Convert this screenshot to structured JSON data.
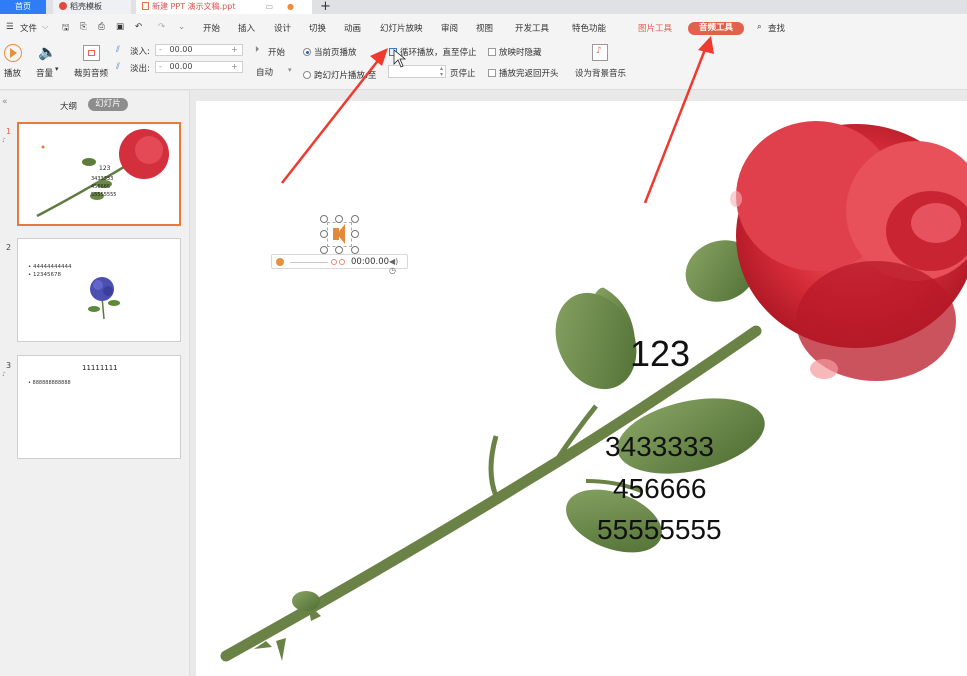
{
  "tabs": {
    "home": "首页",
    "daoke": "稻壳模板",
    "document": "新建 PPT 演示文稿.ppt",
    "new_tab": "+"
  },
  "menu": {
    "file": "文件",
    "items": [
      "开始",
      "插入",
      "设计",
      "切换",
      "动画",
      "幻灯片放映",
      "审阅",
      "视图",
      "开发工具",
      "特色功能"
    ],
    "picture_tools": "图片工具",
    "audio_tools": "音频工具",
    "find": "查找"
  },
  "ribbon": {
    "play": "播放",
    "volume": "音量",
    "trim_audio": "裁剪音频",
    "fade_in_label": "淡入:",
    "fade_in_value": "00.00",
    "fade_out_label": "淡出:",
    "fade_out_value": "00.00",
    "start_label": "开始",
    "start_value": "自动",
    "play_current_page": "当前页播放",
    "play_across_slides": "跨幻灯片播放:至",
    "loop_until_stopped": "循环播放，直至停止",
    "page_stop": "页停止",
    "hide_when_playing": "放映时隐藏",
    "rewind_after_playing": "播放完返回开头",
    "set_background_music": "设为背景音乐"
  },
  "sidebar": {
    "outline_tab": "大纲",
    "slides_tab": "幻灯片",
    "thumbnails": [
      {
        "number": "1",
        "lines": [
          "123",
          "3433333",
          "456666",
          "55555555"
        ]
      },
      {
        "number": "2",
        "lines": [
          "• 44444444444",
          "• 12345678"
        ]
      },
      {
        "number": "3",
        "title": "11111111",
        "lines": [
          "• 888888888888"
        ]
      }
    ]
  },
  "slide": {
    "texts": [
      "123",
      "3433333",
      "456666",
      "55555555"
    ],
    "audio_time": "00:00.00"
  },
  "colors": {
    "accent": "#e2614b",
    "home_tab": "#2f7df6",
    "arrow": "#ee3a2f"
  }
}
